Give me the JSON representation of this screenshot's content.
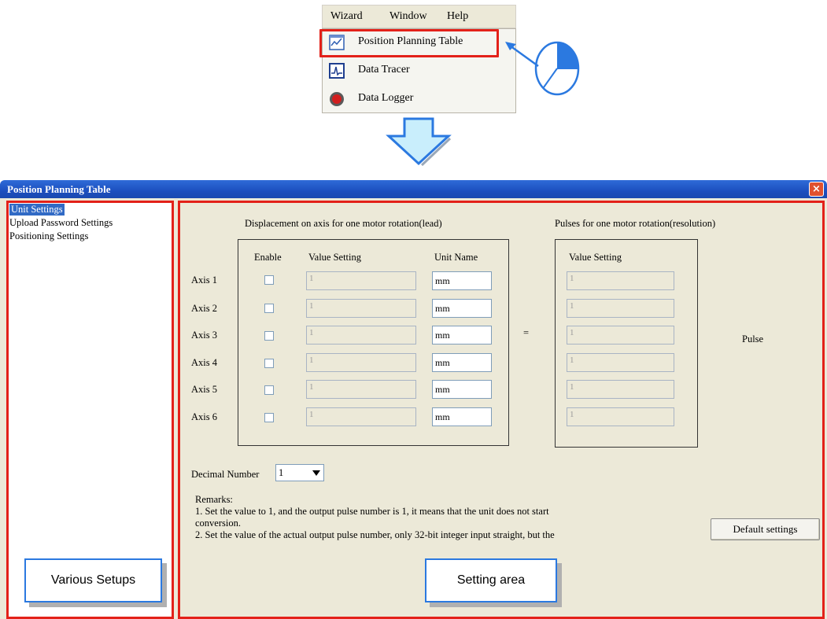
{
  "menu": {
    "items": [
      "Wizard",
      "Window",
      "Help"
    ],
    "dropdown": [
      {
        "label": "Position Planning Table",
        "icon": "chart-icon"
      },
      {
        "label": "Data Tracer",
        "icon": "waveform-icon"
      },
      {
        "label": "Data Logger",
        "icon": "red-record-icon"
      }
    ]
  },
  "dialog": {
    "title": "Position Planning Table",
    "close_label": "×",
    "sidebar": {
      "items": [
        "Unit Settings",
        "Upload Password Settings",
        "Positioning Settings"
      ],
      "selected_index": 0
    },
    "settings": {
      "displacement_title": "Displacement on axis for one motor rotation(lead)",
      "pulses_title": "Pulses for one motor rotation(resolution)",
      "col_enable": "Enable",
      "col_value": "Value Setting",
      "col_unit": "Unit Name",
      "col_value2": "Value Setting",
      "equals": "=",
      "pulse_label": "Pulse",
      "axes": [
        {
          "label": "Axis 1",
          "enabled": false,
          "value": "1",
          "unit": "mm",
          "pulses": "1"
        },
        {
          "label": "Axis 2",
          "enabled": false,
          "value": "1",
          "unit": "mm",
          "pulses": "1"
        },
        {
          "label": "Axis 3",
          "enabled": false,
          "value": "1",
          "unit": "mm",
          "pulses": "1"
        },
        {
          "label": "Axis 4",
          "enabled": false,
          "value": "1",
          "unit": "mm",
          "pulses": "1"
        },
        {
          "label": "Axis 5",
          "enabled": false,
          "value": "1",
          "unit": "mm",
          "pulses": "1"
        },
        {
          "label": "Axis 6",
          "enabled": false,
          "value": "1",
          "unit": "mm",
          "pulses": "1"
        }
      ],
      "decimal_label": "Decimal Number",
      "decimal_value": "1",
      "remarks": {
        "title": "Remarks:",
        "line1": "1. Set the value to 1, and the output pulse number is 1, it means that the unit does not start",
        "line2": "conversion.",
        "line3": "2. Set the value of the actual output pulse number, only 32-bit integer input straight, but the"
      },
      "default_button": "Default settings"
    }
  },
  "annotations": {
    "left": "Various Setups",
    "right": "Setting area"
  },
  "colors": {
    "highlight_red": "#e32119",
    "callout_blue": "#2b79e0",
    "title_blue": "#1c4fbf",
    "dialog_bg": "#ece9d8"
  }
}
